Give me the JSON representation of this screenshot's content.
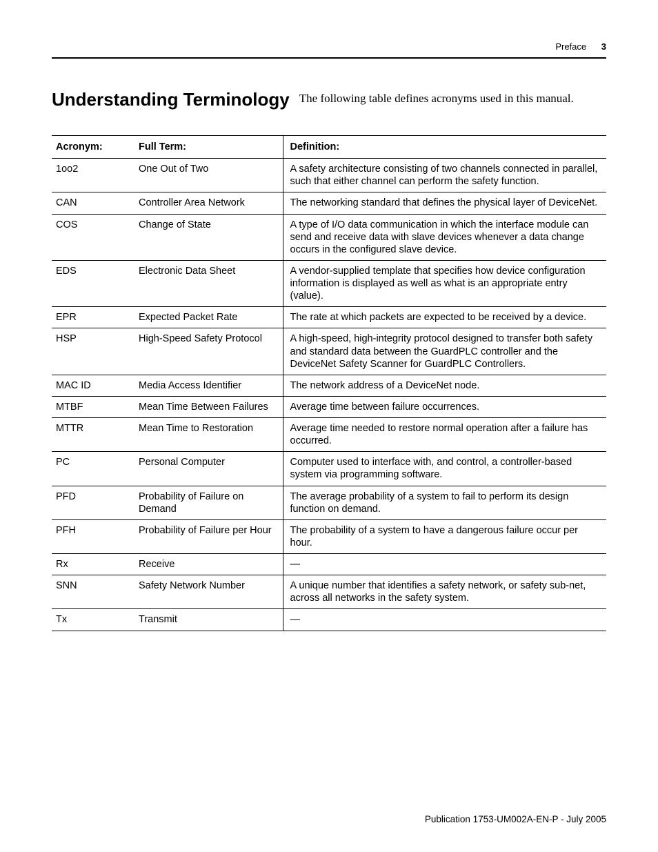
{
  "header": {
    "section": "Preface",
    "page_number": "3"
  },
  "title": "Understanding Terminology",
  "intro": "The following table defines acronyms used in this manual.",
  "table": {
    "columns": {
      "acronym": "Acronym:",
      "full_term": "Full Term:",
      "definition": "Definition:"
    },
    "rows": [
      {
        "acronym": "1oo2",
        "full_term": "One Out of Two",
        "definition": "A safety architecture consisting of two channels connected in parallel, such that either channel can perform the safety function."
      },
      {
        "acronym": "CAN",
        "full_term": "Controller Area Network",
        "definition": "The networking standard that defines the physical layer of DeviceNet."
      },
      {
        "acronym": "COS",
        "full_term": "Change of State",
        "definition": "A type of I/O data communication in which the interface module can send and receive data with slave devices whenever a data change occurs in the configured slave device."
      },
      {
        "acronym": "EDS",
        "full_term": "Electronic Data Sheet",
        "definition": "A vendor-supplied template that specifies how device configuration information is displayed as well as what is an appropriate entry (value)."
      },
      {
        "acronym": "EPR",
        "full_term": "Expected Packet Rate",
        "definition": "The rate at which packets are expected to be received by a device."
      },
      {
        "acronym": "HSP",
        "full_term": "High-Speed Safety Protocol",
        "definition": "A high-speed, high-integrity protocol designed to transfer both safety and standard data between the GuardPLC controller and the DeviceNet Safety Scanner for GuardPLC Controllers."
      },
      {
        "acronym": "MAC ID",
        "full_term": "Media Access Identifier",
        "definition": "The network address of a DeviceNet node."
      },
      {
        "acronym": "MTBF",
        "full_term": "Mean Time Between Failures",
        "definition": "Average time between failure occurrences."
      },
      {
        "acronym": "MTTR",
        "full_term": "Mean Time to Restoration",
        "definition": "Average time needed to restore normal operation after a failure has occurred."
      },
      {
        "acronym": "PC",
        "full_term": "Personal Computer",
        "definition": "Computer used to interface with, and control, a controller-based system via programming software."
      },
      {
        "acronym": "PFD",
        "full_term": "Probability of Failure on Demand",
        "definition": "The average probability of a system to fail to perform its design function on demand."
      },
      {
        "acronym": "PFH",
        "full_term": "Probability of Failure per Hour",
        "definition": "The probability of a system to have a dangerous failure occur per hour."
      },
      {
        "acronym": "Rx",
        "full_term": "Receive",
        "definition": "—"
      },
      {
        "acronym": "SNN",
        "full_term": "Safety Network Number",
        "definition": "A unique number that identifies a safety network, or safety sub-net, across all networks in the safety system."
      },
      {
        "acronym": "Tx",
        "full_term": "Transmit",
        "definition": "—"
      }
    ]
  },
  "footer": "Publication 1753-UM002A-EN-P - July 2005"
}
